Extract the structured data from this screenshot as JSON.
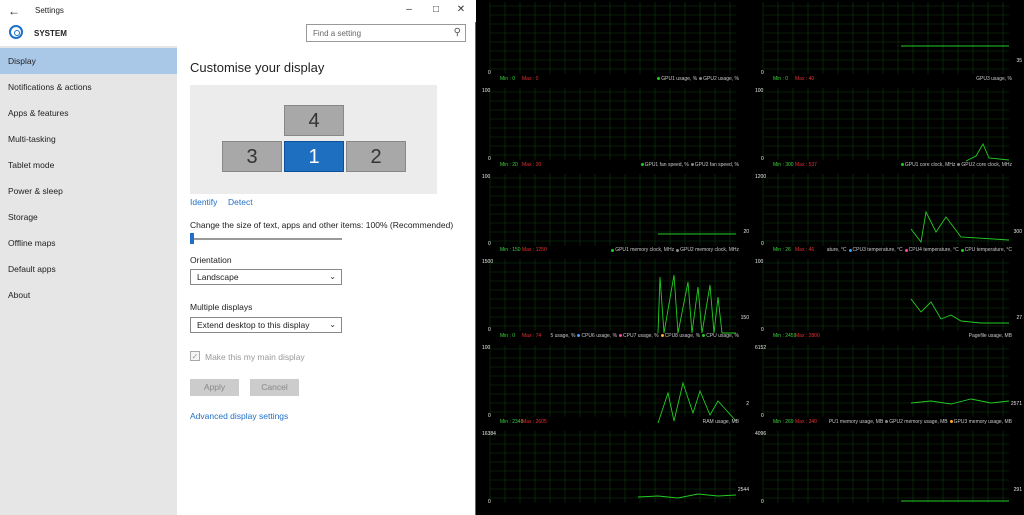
{
  "window": {
    "title": "Settings",
    "section": "SYSTEM",
    "search_placeholder": "Find a setting"
  },
  "sidebar": {
    "items": [
      {
        "label": "Display",
        "active": true
      },
      {
        "label": "Notifications & actions",
        "active": false
      },
      {
        "label": "Apps & features",
        "active": false
      },
      {
        "label": "Multi-tasking",
        "active": false
      },
      {
        "label": "Tablet mode",
        "active": false
      },
      {
        "label": "Power & sleep",
        "active": false
      },
      {
        "label": "Storage",
        "active": false
      },
      {
        "label": "Offline maps",
        "active": false
      },
      {
        "label": "Default apps",
        "active": false
      },
      {
        "label": "About",
        "active": false
      }
    ]
  },
  "display": {
    "title": "Customise your display",
    "monitors": [
      "3",
      "1",
      "2",
      "4"
    ],
    "identify": "Identify",
    "detect": "Detect",
    "scale_label": "Change the size of text, apps and other items: 100% (Recommended)",
    "scale_percent": 100,
    "orientation_label": "Orientation",
    "orientation_value": "Landscape",
    "multiple_label": "Multiple displays",
    "multiple_value": "Extend desktop to this display",
    "main_display_label": "Make this my main display",
    "main_display_checked": true,
    "apply": "Apply",
    "cancel": "Cancel",
    "advanced": "Advanced display settings"
  },
  "monitor": {
    "colors": {
      "min": "#3bd23b",
      "max": "#e53030",
      "grid": "#0e3b0e",
      "line": "#22cc22"
    },
    "panels": [
      {
        "top_value": "",
        "bottom_value": "0",
        "min": "Min : 0",
        "max": "Max : 0",
        "series": [
          {
            "name": "GPU1 usage, %",
            "color": "#22cc22"
          },
          {
            "name": "GPU2 usage, %",
            "color": "#888888"
          }
        ],
        "current": ""
      },
      {
        "top_value": "",
        "bottom_value": "0",
        "min": "Min : 0",
        "max": "Max : 40",
        "series": [
          {
            "name": "GPU3 usage, %",
            "color": ""
          }
        ],
        "current": "35"
      },
      {
        "top_value": "100",
        "bottom_value": "0",
        "min": "Min : 20",
        "max": "Max : 20",
        "series": [
          {
            "name": "GPU1 fan speed, %",
            "color": "#22cc22"
          },
          {
            "name": "GPU2 fan speed, %",
            "color": "#888888"
          }
        ],
        "current": ""
      },
      {
        "top_value": "100",
        "bottom_value": "0",
        "min": "Min : 300",
        "max": "Max : 537",
        "series": [
          {
            "name": "GPU1 core clock, MHz",
            "color": "#22cc22"
          },
          {
            "name": "GPU2 core clock, MHz",
            "color": "#888888"
          }
        ],
        "current": ""
      },
      {
        "top_value": "100",
        "bottom_value": "0",
        "min": "Min : 150",
        "max": "Max : 1250",
        "series": [
          {
            "name": "GPU1 memory clock, MHz",
            "color": "#22cc22"
          },
          {
            "name": "GPU2 memory clock, MHz",
            "color": "#888888"
          }
        ],
        "current": "20"
      },
      {
        "top_value": "1200",
        "bottom_value": "0",
        "min": "Min : 26",
        "max": "Max : 46",
        "series": [
          {
            "name": "ature, °C",
            "color": ""
          },
          {
            "name": "CPU3 temperature, °C",
            "color": "#3aa0ff"
          },
          {
            "name": "CPU4 temperature, °C",
            "color": "#ff44aa"
          },
          {
            "name": "CPU temperature, °C",
            "color": "#22cc22"
          }
        ],
        "current": "300"
      },
      {
        "top_value": "1500",
        "bottom_value": "0",
        "min": "Min : 0",
        "max": "Max : 74",
        "series": [
          {
            "name": "5 usage, %",
            "color": ""
          },
          {
            "name": "CPU6 usage, %",
            "color": "#3aa0ff"
          },
          {
            "name": "CPU7 usage, %",
            "color": "#ff44aa"
          },
          {
            "name": "CPU8 usage, %",
            "color": "#ffaa22"
          },
          {
            "name": "CPU usage, %",
            "color": "#22cc22"
          }
        ],
        "current": "150"
      },
      {
        "top_value": "100",
        "bottom_value": "0",
        "min": "Min : 2459",
        "max": "Max : 2800",
        "series": [
          {
            "name": "Pagefile usage, MB",
            "color": ""
          }
        ],
        "current": "27"
      },
      {
        "top_value": "100",
        "bottom_value": "0",
        "min": "Min : 2348",
        "max": "Max : 2605",
        "series": [
          {
            "name": "RAM usage, MB",
            "color": ""
          }
        ],
        "current": "2"
      },
      {
        "top_value": "6152",
        "bottom_value": "0",
        "min": "Min : 269",
        "max": "Max : 340",
        "series": [
          {
            "name": "PU1 memory usage, MB",
            "color": ""
          },
          {
            "name": "GPU2 memory usage, MB",
            "color": "#888888"
          },
          {
            "name": "GPU3 memory usage, MB",
            "color": "#ffaa22"
          }
        ],
        "current": "2571"
      },
      {
        "top_value": "16384",
        "bottom_value": "0",
        "min": "",
        "max": "",
        "series": [],
        "current": "2544"
      },
      {
        "top_value": "4096",
        "bottom_value": "0",
        "min": "",
        "max": "",
        "series": [],
        "current": "291"
      }
    ]
  }
}
